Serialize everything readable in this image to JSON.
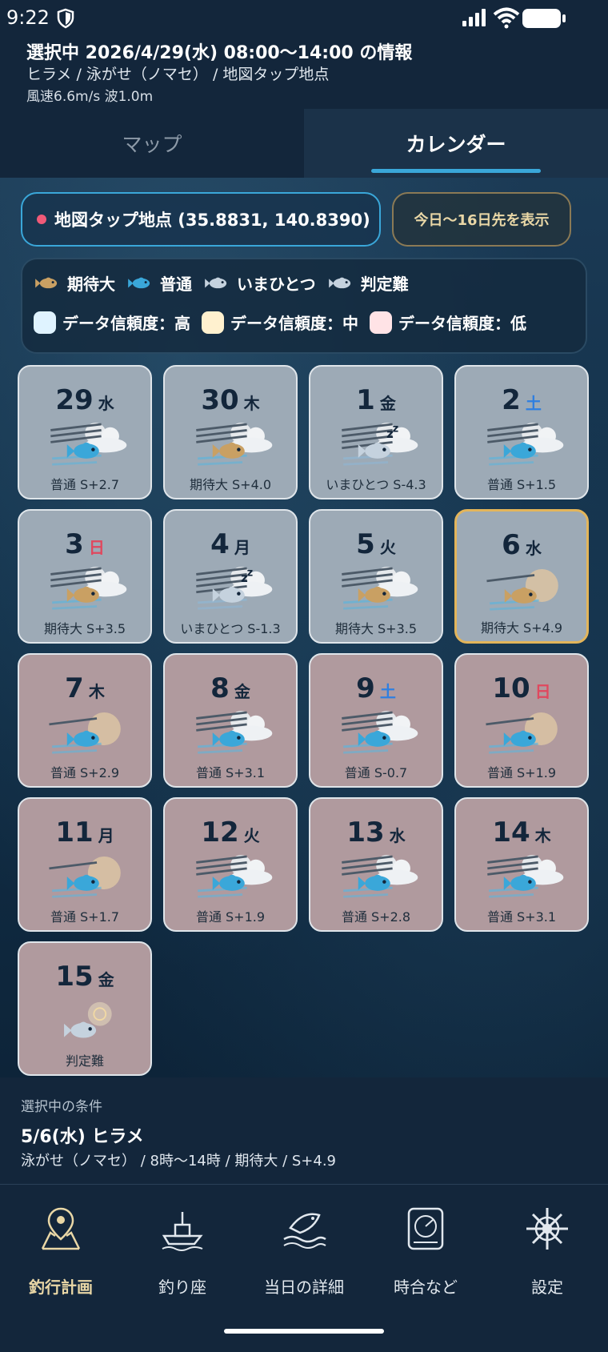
{
  "status": {
    "time": "9:22"
  },
  "header": {
    "line1": "選択中 2026/4/29(水) 08:00〜14:00 の情報",
    "line2": "ヒラメ / 泳がせ（ノマセ） / 地図タップ地点",
    "line3": "風速6.6m/s  波1.0m"
  },
  "tabs": {
    "map": "マップ",
    "calendar": "カレンダー"
  },
  "location": {
    "label": "地図タップ地点 (35.8831, 140.8390)"
  },
  "range_button": "今日〜16日先を表示",
  "legend": {
    "ratings": [
      {
        "key": "great",
        "label": "期待大",
        "color": "#c9a063"
      },
      {
        "key": "normal",
        "label": "普通",
        "color": "#3aa7d9"
      },
      {
        "key": "poor",
        "label": "いまひとつ",
        "color": "#c5d2de"
      },
      {
        "key": "unknown",
        "label": "判定難",
        "color": "#c5d2de"
      }
    ],
    "reliability": [
      {
        "label": "データ信頼度：高",
        "color": "#dff3ff"
      },
      {
        "label": "データ信頼度：中",
        "color": "#fff1cf"
      },
      {
        "label": "データ信頼度：低",
        "color": "#ffe3e6"
      }
    ]
  },
  "calendar": {
    "days": [
      {
        "day": "29",
        "wd": "水",
        "rating": "normal",
        "label": "普通 S+2.7",
        "rel": "hi",
        "weather": "cloudy-wind"
      },
      {
        "day": "30",
        "wd": "木",
        "rating": "great",
        "label": "期待大 S+4.0",
        "rel": "hi",
        "weather": "cloudy-wind"
      },
      {
        "day": "1",
        "wd": "金",
        "rating": "poor",
        "label": "いまひとつ S-4.3",
        "rel": "hi",
        "weather": "strong-wind"
      },
      {
        "day": "2",
        "wd": "土",
        "rating": "normal",
        "label": "普通 S+1.5",
        "rel": "hi",
        "weather": "cloudy-wind"
      },
      {
        "day": "3",
        "wd": "日",
        "rating": "great",
        "label": "期待大 S+3.5",
        "rel": "hi",
        "weather": "cloudy-wind"
      },
      {
        "day": "4",
        "wd": "月",
        "rating": "poor",
        "label": "いまひとつ S-1.3",
        "rel": "hi",
        "weather": "strong-wind"
      },
      {
        "day": "5",
        "wd": "火",
        "rating": "great",
        "label": "期待大 S+3.5",
        "rel": "hi",
        "weather": "cloudy-wind"
      },
      {
        "day": "6",
        "wd": "水",
        "rating": "great",
        "label": "期待大 S+4.9",
        "rel": "hi",
        "weather": "sunny-wind",
        "selected": true
      },
      {
        "day": "7",
        "wd": "木",
        "rating": "normal",
        "label": "普通 S+2.9",
        "rel": "lo",
        "weather": "sunny-wind"
      },
      {
        "day": "8",
        "wd": "金",
        "rating": "normal",
        "label": "普通 S+3.1",
        "rel": "lo",
        "weather": "cloudy-wind"
      },
      {
        "day": "9",
        "wd": "土",
        "rating": "normal",
        "label": "普通 S-0.7",
        "rel": "lo",
        "weather": "cloudy-wind"
      },
      {
        "day": "10",
        "wd": "日",
        "rating": "normal",
        "label": "普通 S+1.9",
        "rel": "lo",
        "weather": "sunny-wind"
      },
      {
        "day": "11",
        "wd": "月",
        "rating": "normal",
        "label": "普通 S+1.7",
        "rel": "lo",
        "weather": "sunny-wind"
      },
      {
        "day": "12",
        "wd": "火",
        "rating": "normal",
        "label": "普通 S+1.9",
        "rel": "lo",
        "weather": "cloudy-wind"
      },
      {
        "day": "13",
        "wd": "水",
        "rating": "normal",
        "label": "普通 S+2.8",
        "rel": "lo",
        "weather": "cloudy-wind"
      },
      {
        "day": "14",
        "wd": "木",
        "rating": "normal",
        "label": "普通 S+3.1",
        "rel": "lo",
        "weather": "cloudy-wind"
      },
      {
        "day": "15",
        "wd": "金",
        "rating": "unknown",
        "label": "判定難",
        "rel": "lo",
        "weather": "unknown"
      }
    ]
  },
  "selected_conditions": {
    "title": "選択中の条件",
    "heading": "5/6(水)  ヒラメ",
    "sub": "泳がせ（ノマセ） / 8時〜14時 / 期待大 / S+4.9"
  },
  "nav": [
    {
      "label": "釣行計画",
      "icon": "map-pin-icon",
      "active": true
    },
    {
      "label": "釣り座",
      "icon": "boat-icon",
      "active": false
    },
    {
      "label": "当日の詳細",
      "icon": "fish-wave-icon",
      "active": false
    },
    {
      "label": "時合など",
      "icon": "radar-icon",
      "active": false
    },
    {
      "label": "設定",
      "icon": "helm-icon",
      "active": false
    }
  ]
}
